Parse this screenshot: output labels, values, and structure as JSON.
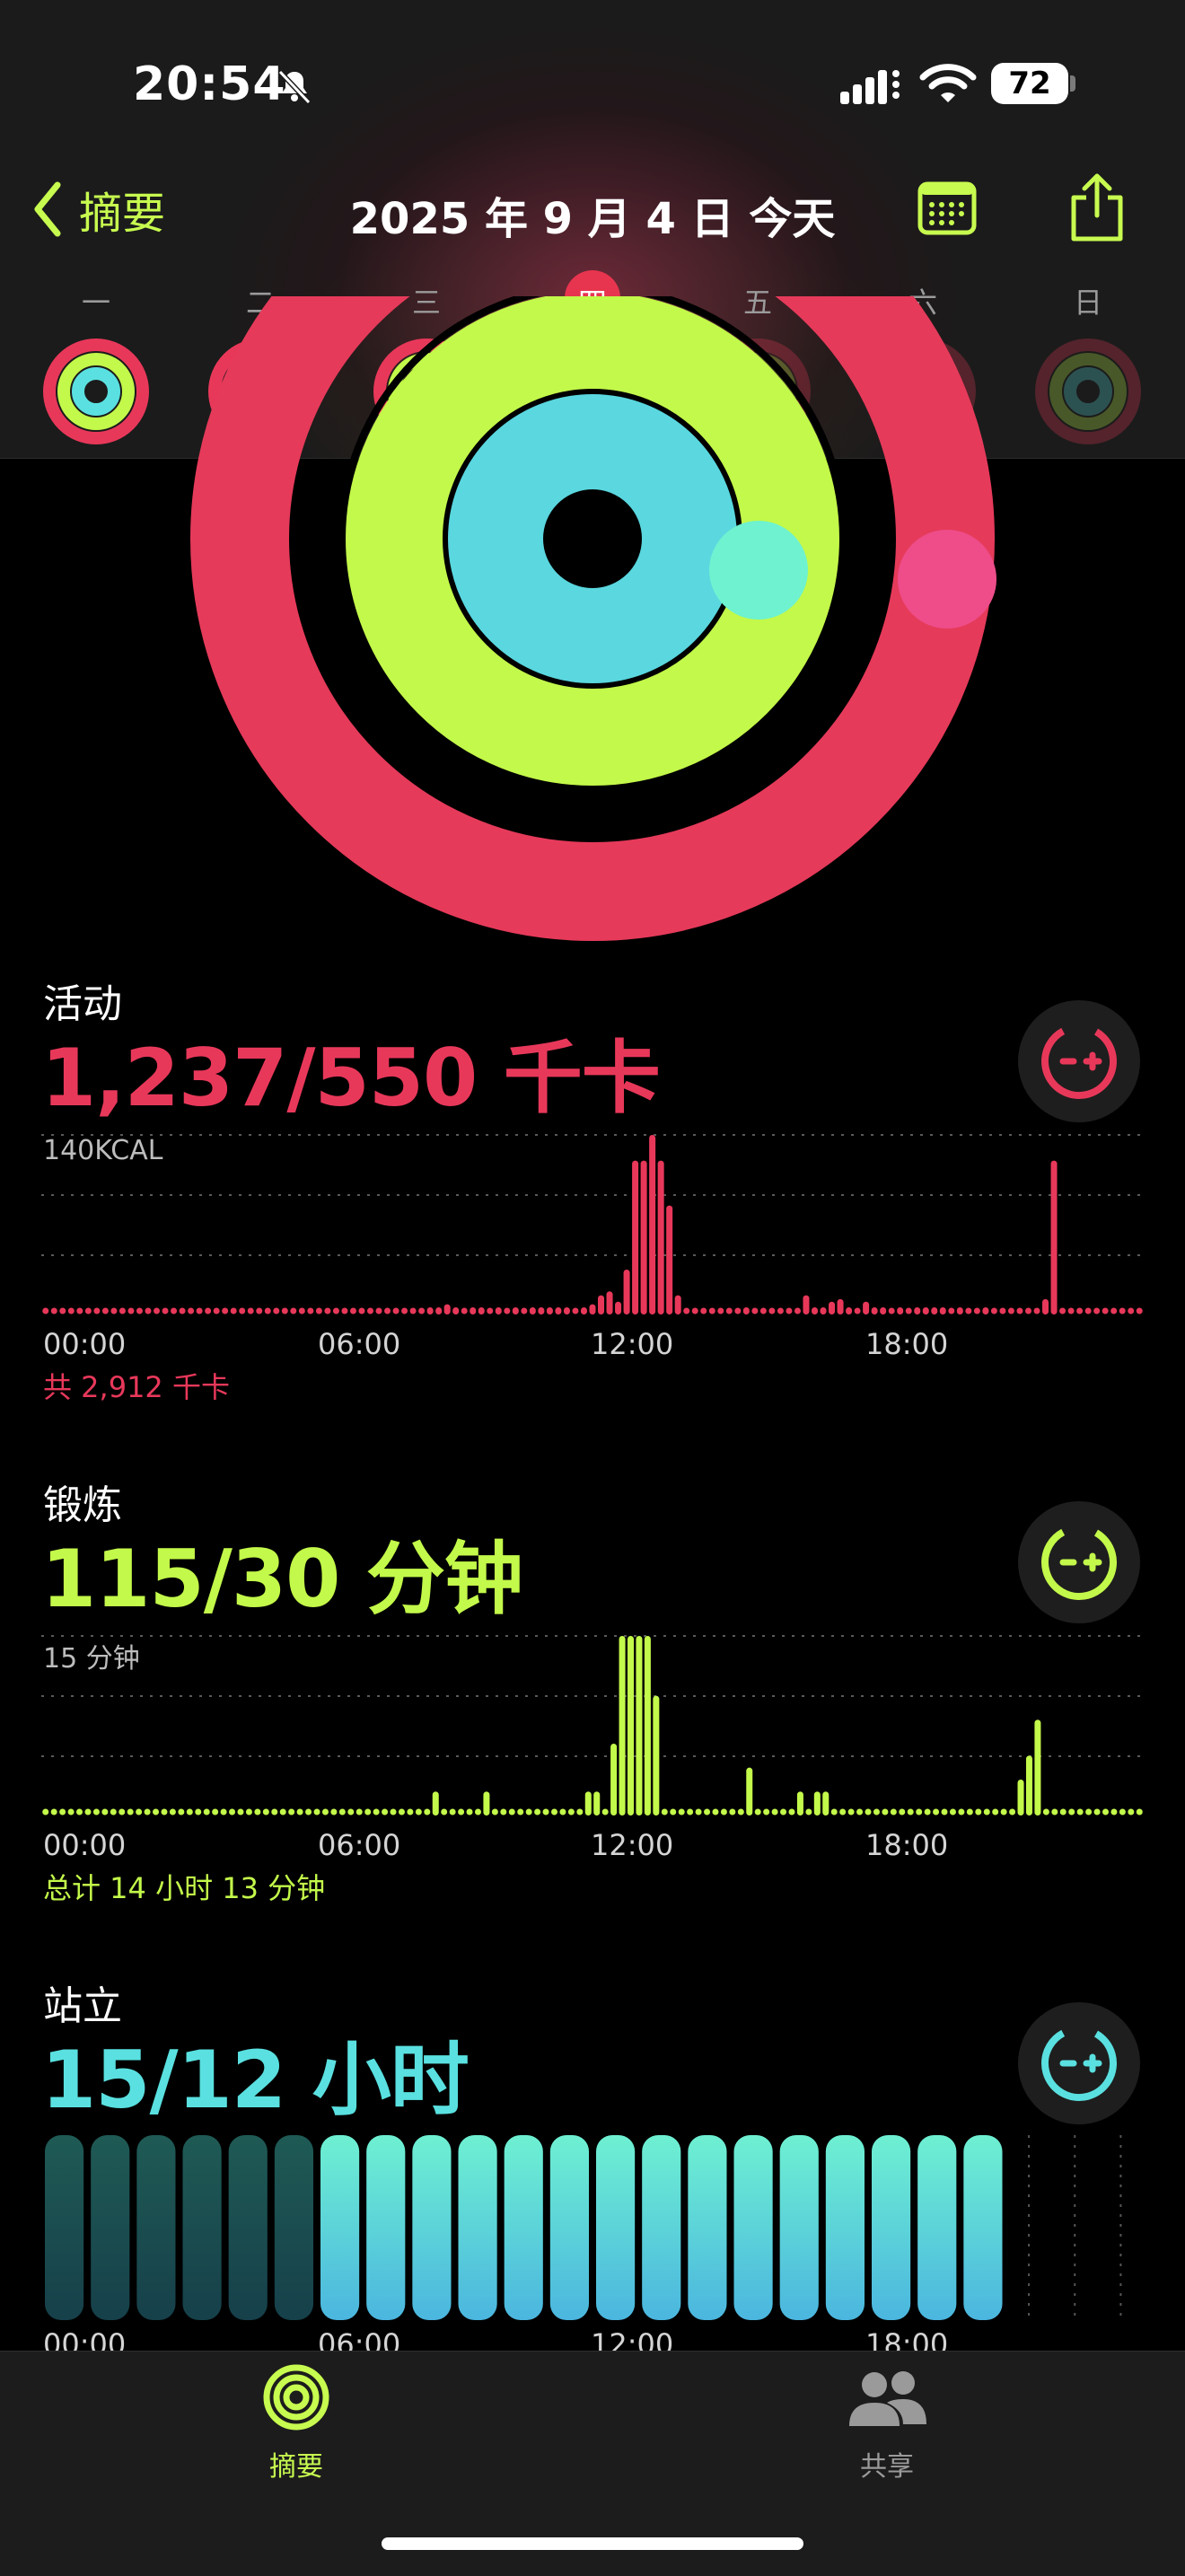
{
  "status_bar": {
    "time": "20:54",
    "battery": "72"
  },
  "nav": {
    "back_label": "摘要",
    "title": "2025 年 9 月 4 日 今天"
  },
  "week": {
    "days": [
      "一",
      "二",
      "三",
      "四",
      "五",
      "六",
      "日"
    ],
    "today_index": 3
  },
  "colors": {
    "move": "#e8385a",
    "exercise": "#c3f94a",
    "stand": "#5ae0e0",
    "accent": "#c7fb4f"
  },
  "activity": {
    "title": "活动",
    "value": "1,237/550 千卡",
    "scale_label": "140KCAL",
    "total": "共 2,912 千卡",
    "x_ticks": [
      "00:00",
      "06:00",
      "12:00",
      "18:00"
    ]
  },
  "exercise": {
    "title": "锻炼",
    "value": "115/30 分钟",
    "scale_label": "15 分钟",
    "total": "总计 14 小时 13 分钟",
    "x_ticks": [
      "00:00",
      "06:00",
      "12:00",
      "18:00"
    ]
  },
  "stand": {
    "title": "站立",
    "value": "15/12 小时",
    "x_ticks": [
      "00:00",
      "06:00",
      "12:00",
      "18:00"
    ]
  },
  "chart_data": [
    {
      "type": "bar",
      "name": "activity",
      "ylabel": "140KCAL",
      "ylim": [
        0,
        140
      ],
      "x": [
        "00:00",
        "06:00",
        "12:00",
        "18:00"
      ],
      "values": [
        0,
        0,
        0,
        0,
        0,
        0,
        0,
        0,
        0,
        0,
        0,
        0,
        0,
        0,
        0,
        0,
        0,
        0,
        0,
        0,
        0,
        0,
        0,
        0,
        0,
        0,
        0,
        0,
        0,
        0,
        0,
        0,
        0,
        0,
        0,
        0,
        0,
        0,
        0,
        0,
        0,
        0,
        0,
        0,
        0,
        2,
        5,
        8,
        2,
        0,
        3,
        5,
        0,
        2,
        0,
        1,
        0,
        1,
        2,
        1,
        1,
        4,
        0,
        3,
        8,
        15,
        18,
        10,
        35,
        120,
        120,
        140,
        120,
        85,
        15,
        0,
        0,
        0,
        0,
        0,
        0,
        0,
        1,
        0,
        0,
        0,
        0,
        0,
        0,
        15,
        5,
        2,
        10,
        12,
        1,
        0,
        10,
        2,
        1,
        0,
        2,
        0,
        2,
        1,
        1,
        2,
        0,
        1,
        0,
        0,
        1,
        0,
        0,
        0,
        0,
        0,
        0,
        12,
        120,
        0,
        0,
        0,
        0,
        0,
        0,
        0,
        0,
        0,
        0
      ]
    },
    {
      "type": "bar",
      "name": "exercise",
      "ylabel": "15 分钟",
      "ylim": [
        0,
        15
      ],
      "x": [
        "00:00",
        "06:00",
        "12:00",
        "18:00"
      ],
      "values": [
        0,
        0,
        0,
        0,
        0,
        0,
        0,
        0,
        0,
        0,
        0,
        0,
        0,
        0,
        0,
        0,
        0,
        0,
        0,
        0,
        0,
        0,
        0,
        0,
        0,
        0,
        0,
        0,
        0,
        0,
        0,
        0,
        0,
        0,
        0,
        0,
        0,
        0,
        0,
        0,
        0,
        0,
        0,
        0,
        0,
        0,
        2,
        0,
        0,
        0,
        0,
        0,
        2,
        0,
        0,
        0,
        0,
        0,
        0,
        0,
        0,
        0,
        0,
        0,
        2,
        2,
        0,
        6,
        15,
        15,
        15,
        15,
        10,
        0,
        0,
        0,
        0,
        0,
        0,
        0,
        0,
        0,
        0,
        4,
        0,
        0,
        0,
        0,
        0,
        2,
        0,
        2,
        2,
        0,
        0,
        0,
        0,
        0,
        0,
        0,
        0,
        0,
        0,
        0,
        0,
        0,
        0,
        0,
        0,
        0,
        0,
        0,
        0,
        0,
        0,
        3,
        5,
        8,
        0,
        0,
        0,
        0,
        0,
        0,
        0,
        0,
        0,
        0,
        0,
        0
      ]
    },
    {
      "type": "bar",
      "name": "stand",
      "x": [
        "00:00",
        "06:00",
        "12:00",
        "18:00"
      ],
      "hours_stood": [
        true,
        true,
        true,
        true,
        true,
        true,
        true,
        true,
        true,
        true,
        true,
        true,
        true,
        true,
        true,
        true,
        true,
        true,
        true,
        true,
        true,
        false,
        false,
        false
      ],
      "highlight_from": 6
    }
  ],
  "tabs": [
    {
      "label": "摘要",
      "active": true
    },
    {
      "label": "共享",
      "active": false
    }
  ]
}
